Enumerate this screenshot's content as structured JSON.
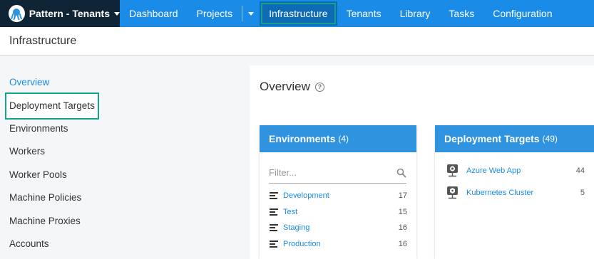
{
  "space": {
    "name": "Pattern - Tenants",
    "icon": "octopus-logo-icon"
  },
  "nav": {
    "dashboard": "Dashboard",
    "projects": "Projects",
    "infrastructure": "Infrastructure",
    "tenants": "Tenants",
    "library": "Library",
    "tasks": "Tasks",
    "configuration": "Configuration"
  },
  "page": {
    "title": "Infrastructure"
  },
  "sidebar": {
    "items": [
      {
        "label": "Overview"
      },
      {
        "label": "Deployment Targets"
      },
      {
        "label": "Environments"
      },
      {
        "label": "Workers"
      },
      {
        "label": "Worker Pools"
      },
      {
        "label": "Machine Policies"
      },
      {
        "label": "Machine Proxies"
      },
      {
        "label": "Accounts"
      }
    ]
  },
  "main": {
    "title": "Overview",
    "help_icon": "help-circle-icon"
  },
  "environments": {
    "title": "Environments",
    "count": "(4)",
    "filter_placeholder": "Filter...",
    "rows": [
      {
        "name": "Development",
        "count": "17"
      },
      {
        "name": "Test",
        "count": "15"
      },
      {
        "name": "Staging",
        "count": "16"
      },
      {
        "name": "Production",
        "count": "16"
      }
    ]
  },
  "targets": {
    "title": "Deployment Targets",
    "count": "(49)",
    "rows": [
      {
        "name": "Azure Web App",
        "count": "44"
      },
      {
        "name": "Kubernetes Cluster",
        "count": "5"
      }
    ]
  },
  "colors": {
    "nav": "#1a8ce8",
    "space_bg": "#0f2535",
    "highlight": "#15a28c",
    "card_header": "#2f93e0"
  }
}
